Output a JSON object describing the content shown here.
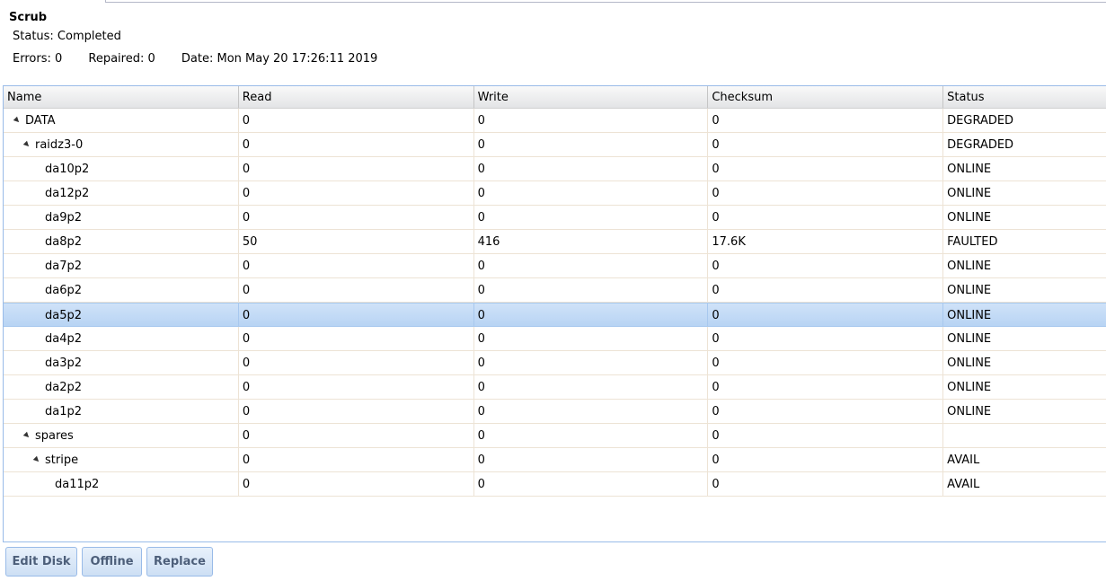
{
  "scrub": {
    "title": "Scrub",
    "status": "Status: Completed",
    "errors": "Errors: 0",
    "repaired": "Repaired: 0",
    "date": "Date: Mon May 20 17:26:11 2019"
  },
  "grid": {
    "columns": [
      "Name",
      "Read",
      "Write",
      "Checksum",
      "Status"
    ],
    "rows": [
      {
        "name": "DATA",
        "read": "0",
        "write": "0",
        "checksum": "0",
        "status": "DEGRADED"
      },
      {
        "name": "raidz3-0",
        "read": "0",
        "write": "0",
        "checksum": "0",
        "status": "DEGRADED"
      },
      {
        "name": "da10p2",
        "read": "0",
        "write": "0",
        "checksum": "0",
        "status": "ONLINE"
      },
      {
        "name": "da12p2",
        "read": "0",
        "write": "0",
        "checksum": "0",
        "status": "ONLINE"
      },
      {
        "name": "da9p2",
        "read": "0",
        "write": "0",
        "checksum": "0",
        "status": "ONLINE"
      },
      {
        "name": "da8p2",
        "read": "50",
        "write": "416",
        "checksum": "17.6K",
        "status": "FAULTED"
      },
      {
        "name": "da7p2",
        "read": "0",
        "write": "0",
        "checksum": "0",
        "status": "ONLINE"
      },
      {
        "name": "da6p2",
        "read": "0",
        "write": "0",
        "checksum": "0",
        "status": "ONLINE"
      },
      {
        "name": "da5p2",
        "read": "0",
        "write": "0",
        "checksum": "0",
        "status": "ONLINE"
      },
      {
        "name": "da4p2",
        "read": "0",
        "write": "0",
        "checksum": "0",
        "status": "ONLINE"
      },
      {
        "name": "da3p2",
        "read": "0",
        "write": "0",
        "checksum": "0",
        "status": "ONLINE"
      },
      {
        "name": "da2p2",
        "read": "0",
        "write": "0",
        "checksum": "0",
        "status": "ONLINE"
      },
      {
        "name": "da1p2",
        "read": "0",
        "write": "0",
        "checksum": "0",
        "status": "ONLINE"
      },
      {
        "name": "spares",
        "read": "0",
        "write": "0",
        "checksum": "0",
        "status": ""
      },
      {
        "name": "stripe",
        "read": "0",
        "write": "0",
        "checksum": "0",
        "status": "AVAIL"
      },
      {
        "name": "da11p2",
        "read": "0",
        "write": "0",
        "checksum": "0",
        "status": "AVAIL"
      }
    ]
  },
  "toolbar": {
    "edit_disk": "Edit Disk",
    "offline": "Offline",
    "replace": "Replace"
  }
}
